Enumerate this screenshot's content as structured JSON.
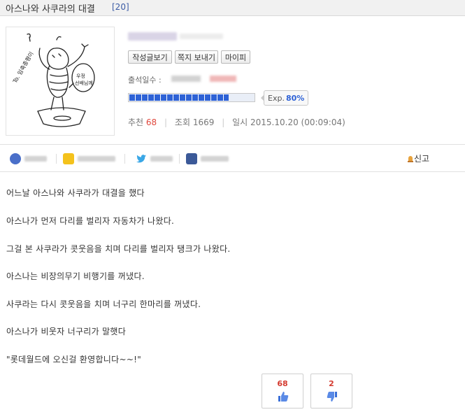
{
  "post": {
    "title": "아스나와 사쿠라의 대결",
    "comment_count": "[20]"
  },
  "profile": {
    "buttons": [
      "작성글보기",
      "쪽지 보내기",
      "마이피"
    ],
    "attendance_label": "출석일수 :",
    "exp_label": "Exp.",
    "exp_percent": "80%",
    "exp_fraction": 0.8
  },
  "meta": {
    "recommend_label": "추천",
    "recommend_value": "68",
    "views_label": "조회",
    "views_value": "1669",
    "date_label": "일시",
    "date_value": "2015.10.20 (00:09:04)"
  },
  "share": {
    "report_label": "신고"
  },
  "body": [
    "어느날 아스나와 사쿠라가 대결을 했다",
    "아스나가 먼저  다리를 벌리자 자동차가 나왔다.",
    "그걸 본 사쿠라가 콧웃음을 치며 다리를 벌리자 탱크가 나왔다.",
    "아스나는 비장의무기 비행기를 꺼냈다.",
    "사쿠라는 다시 콧웃음을 치며 너구리 한마리를 꺼냈다.",
    "아스나가 비웃자 너구리가 말햇다",
    "\"롯데월드에 오신걸 환영합니다~~!\""
  ],
  "votes": {
    "up": "68",
    "down": "2"
  },
  "colors": {
    "accent": "#2e62d6",
    "up": "#d43a2f",
    "link": "#3b5ba5"
  }
}
